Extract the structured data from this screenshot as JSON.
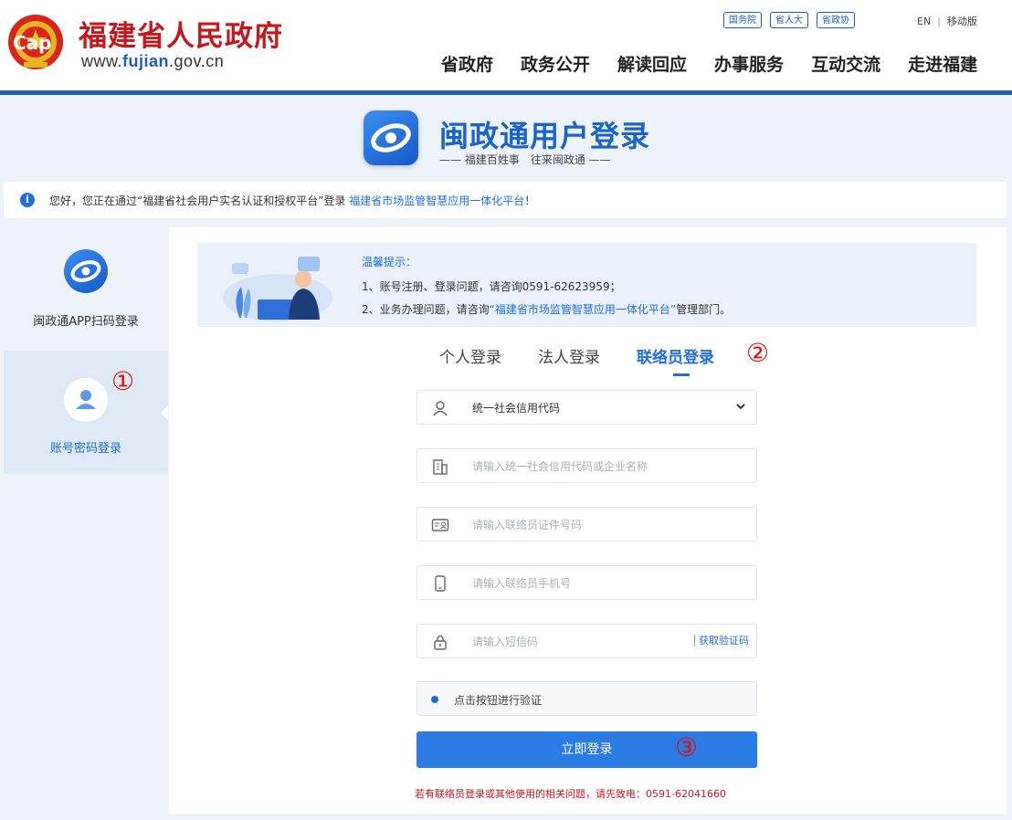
{
  "header": {
    "site_title": "福建省人民政府",
    "url_prefix": "www.",
    "url_domain": "fujian",
    "url_suffix": ".gov.cn",
    "emblem_watermark": "Cap",
    "top_links": [
      "国务院",
      "省人大",
      "省政协"
    ],
    "lang": "EN",
    "mobile": "移动版",
    "nav": [
      "省政府",
      "政务公开",
      "解读回应",
      "办事服务",
      "互动交流",
      "走进福建"
    ]
  },
  "login_header": {
    "title": "闽政通用户登录",
    "slogan": "—— 福建百姓事　往来闽政通 ——"
  },
  "notice": {
    "icon": "i",
    "text": "您好，您正在通过“福建省社会用户实名认证和授权平台”登录",
    "link": "福建省市场监管智慧应用一体化平台",
    "end": "！"
  },
  "sidebar": {
    "qr_label": "闽政通APP扫码登录",
    "account_label": "账号密码登录"
  },
  "annotations": [
    "①",
    "②",
    "③"
  ],
  "tips": {
    "title": "温馨提示：",
    "line1": "1、账号注册、登录问题，请咨询0591-62623959；",
    "line2_prefix": "2、业务办理问题，请咨询",
    "line2_link": "“福建省市场监管智慧应用一体化平台”",
    "line2_suffix": "管理部门。"
  },
  "tabs": [
    "个人登录",
    "法人登录",
    "联络员登录"
  ],
  "form": {
    "select_value": "统一社会信用代码",
    "credit_placeholder": "请输入统一社会信用代码或企业名称",
    "id_placeholder": "请输入联络员证件号码",
    "phone_placeholder": "请输入联络员手机号",
    "sms_placeholder": "请输入短信码",
    "sms_button": "获取验证码",
    "verify_text": "点击按钮进行验证",
    "login_button": "立即登录",
    "footer_note": "若有联络员登录或其他使用的相关问题，请先致电：0591-62041660"
  },
  "colors": {
    "brand_blue": "#1e6fd9",
    "brand_red": "#c8161d",
    "header_bar": "#1e5fb3"
  }
}
